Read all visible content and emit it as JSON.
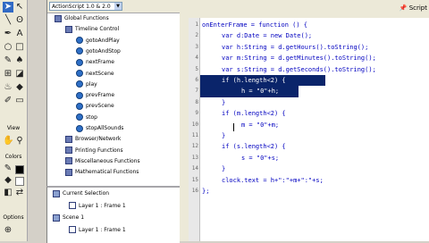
{
  "tools": {
    "view_label": "View",
    "colors_label": "Colors",
    "options_label": "Options"
  },
  "actions_panel": {
    "version_select": "ActionScript 1.0 & 2.0",
    "categories": [
      {
        "label": "Global Functions",
        "indent": 0,
        "kind": "book"
      },
      {
        "label": "Timeline Control",
        "indent": 1,
        "kind": "book"
      },
      {
        "label": "gotoAndPlay",
        "indent": 2,
        "kind": "action"
      },
      {
        "label": "gotoAndStop",
        "indent": 2,
        "kind": "action"
      },
      {
        "label": "nextFrame",
        "indent": 2,
        "kind": "action"
      },
      {
        "label": "nextScene",
        "indent": 2,
        "kind": "action"
      },
      {
        "label": "play",
        "indent": 2,
        "kind": "action"
      },
      {
        "label": "prevFrame",
        "indent": 2,
        "kind": "action"
      },
      {
        "label": "prevScene",
        "indent": 2,
        "kind": "action"
      },
      {
        "label": "stop",
        "indent": 2,
        "kind": "action"
      },
      {
        "label": "stopAllSounds",
        "indent": 2,
        "kind": "action"
      },
      {
        "label": "Browser/Network",
        "indent": 1,
        "kind": "book"
      },
      {
        "label": "Printing Functions",
        "indent": 1,
        "kind": "book"
      },
      {
        "label": "Miscellaneous Functions",
        "indent": 1,
        "kind": "book"
      },
      {
        "label": "Mathematical Functions",
        "indent": 1,
        "kind": "book"
      }
    ]
  },
  "scene_pane": {
    "items": [
      {
        "label": "Current Selection",
        "indent": 0
      },
      {
        "label": "Layer 1 : Frame 1",
        "indent": 1
      },
      {
        "label": "Scene 1",
        "indent": 0
      },
      {
        "label": "Layer 1 : Frame 1",
        "indent": 1
      }
    ]
  },
  "editor": {
    "script_button": "Script",
    "lines": [
      {
        "n": "1",
        "text": "onEnterFrame = function () {",
        "indent": 0
      },
      {
        "n": "2",
        "text": "var d:Date = new Date();",
        "indent": 1
      },
      {
        "n": "3",
        "text": "var h:String = d.getHours().toString();",
        "indent": 1
      },
      {
        "n": "4",
        "text": "var m:String = d.getMinutes().toString();",
        "indent": 1
      },
      {
        "n": "5",
        "text": "var s:String = d.getSeconds().toString();",
        "indent": 1
      },
      {
        "n": "6",
        "text": "if (h.length<2) {",
        "indent": 1,
        "highlight": true
      },
      {
        "n": "7",
        "text": "h = \"0\"+h;",
        "indent": 2,
        "highlight": true
      },
      {
        "n": "8",
        "text": "}",
        "indent": 1
      },
      {
        "n": "9",
        "text": "if (m.length<2) {",
        "indent": 1
      },
      {
        "n": "10",
        "text": "m = \"0\"+m;",
        "indent": 2
      },
      {
        "n": "11",
        "text": "}",
        "indent": 1
      },
      {
        "n": "12",
        "text": "if (s.length<2) {",
        "indent": 1
      },
      {
        "n": "13",
        "text": "s = \"0\"+s;",
        "indent": 2
      },
      {
        "n": "14",
        "text": "}",
        "indent": 1
      },
      {
        "n": "15",
        "text": "clock.text = h+\":\"+m+\":\"+s;",
        "indent": 1
      },
      {
        "n": "16",
        "text": "};",
        "indent": 0
      }
    ]
  }
}
